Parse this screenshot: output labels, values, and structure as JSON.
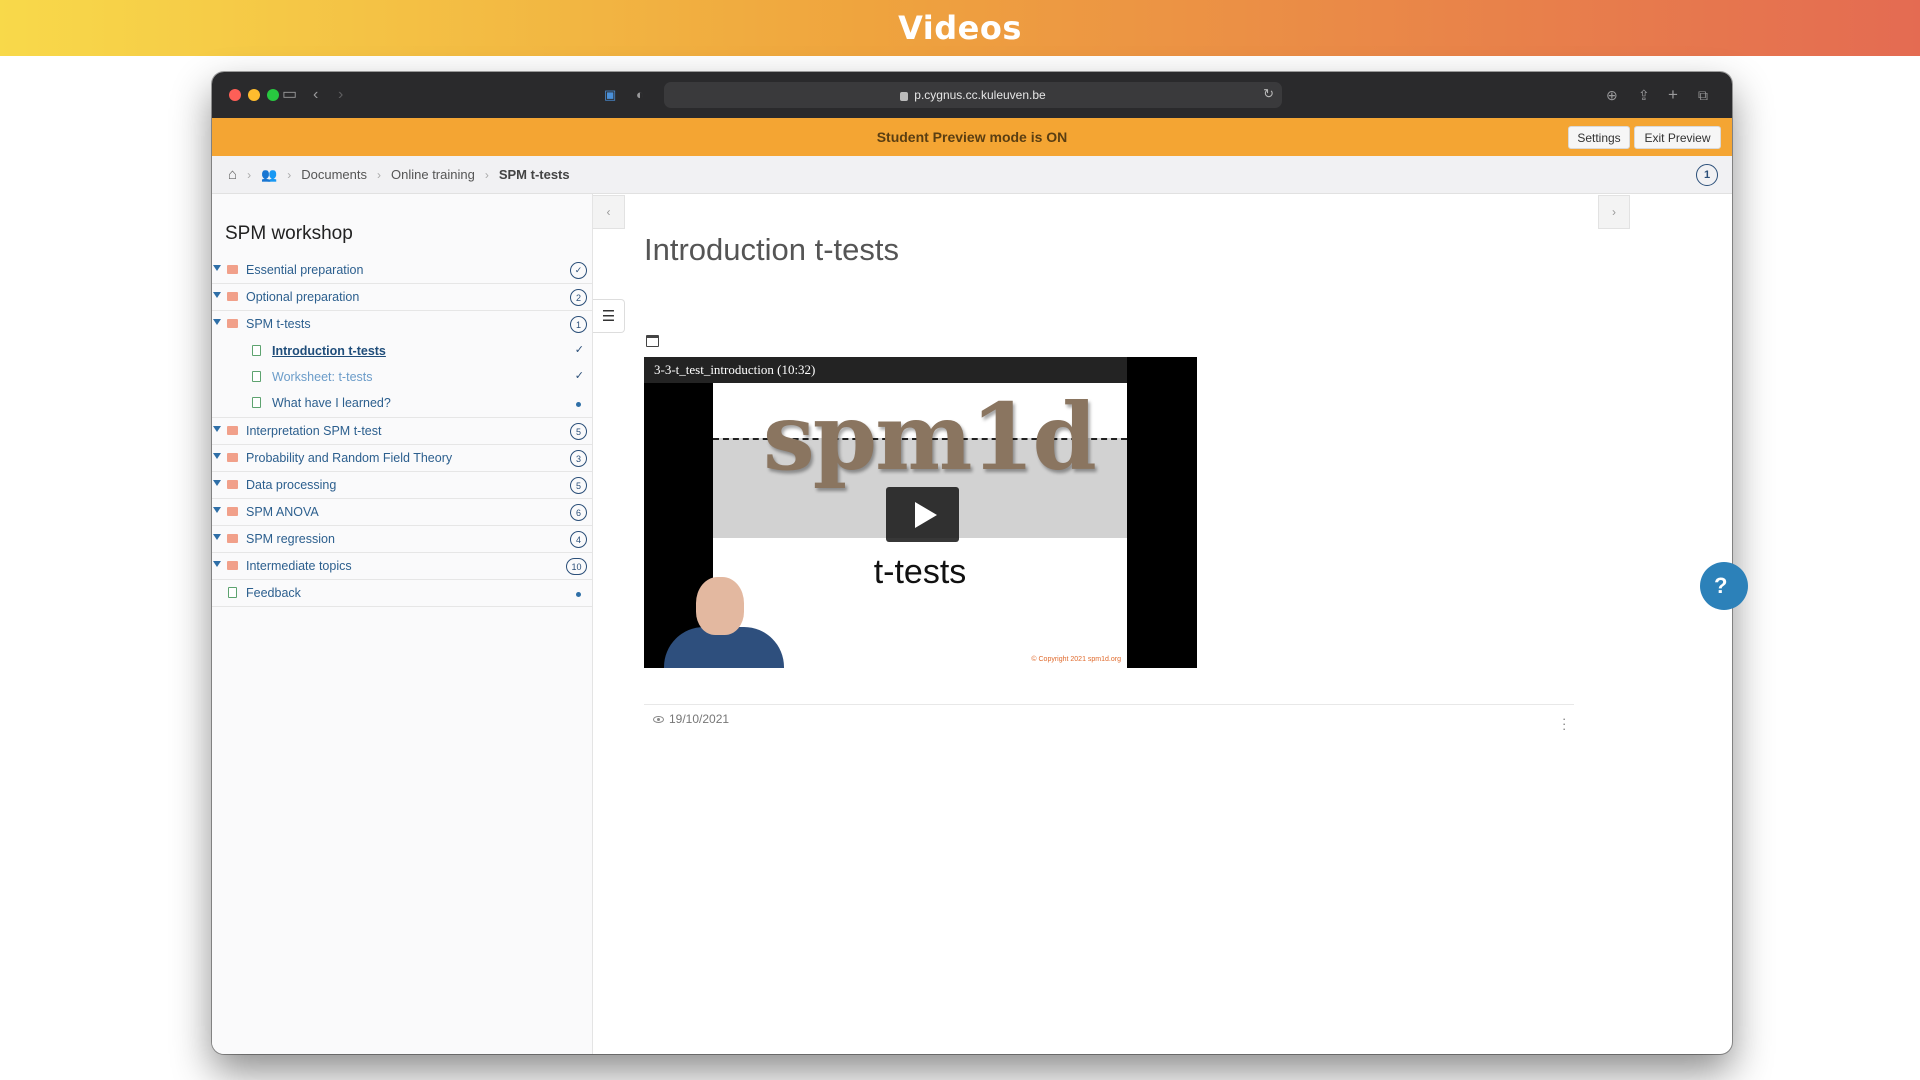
{
  "banner": {
    "title": "Videos"
  },
  "browser": {
    "url": "p.cygnus.cc.kuleuven.be"
  },
  "preview": {
    "message": "Student Preview mode is ON",
    "settings_label": "Settings",
    "exit_label": "Exit Preview"
  },
  "breadcrumb": {
    "items": [
      "Documents",
      "Online training",
      "SPM t-tests"
    ],
    "badge": "1"
  },
  "sidebar": {
    "title": "SPM workshop",
    "items": [
      {
        "label": "Essential preparation",
        "status": "✓"
      },
      {
        "label": "Optional preparation",
        "status": "2"
      },
      {
        "label": "SPM t-tests",
        "status": "1"
      },
      {
        "label": "Introduction t-tests",
        "status": "✓"
      },
      {
        "label": "Worksheet: t-tests",
        "status": "✓"
      },
      {
        "label": "What have I learned?",
        "status": "dot"
      },
      {
        "label": "Interpretation SPM t-test",
        "status": "5"
      },
      {
        "label": "Probability and Random Field Theory",
        "status": "3"
      },
      {
        "label": "Data processing",
        "status": "5"
      },
      {
        "label": "SPM ANOVA",
        "status": "6"
      },
      {
        "label": "SPM regression",
        "status": "4"
      },
      {
        "label": "Intermediate topics",
        "status": "10"
      },
      {
        "label": "Feedback",
        "status": "dot"
      }
    ]
  },
  "content": {
    "title": "Introduction t-tests",
    "video": {
      "caption": "3-3-t_test_introduction (10:32)",
      "slide_logo": "spm1d",
      "slide_subtitle": "t-tests",
      "copyright": "© Copyright 2021 spm1d.org"
    },
    "date": "19/10/2021"
  },
  "help": {
    "label": "?"
  },
  "colors": {
    "accent": "#2b4f79",
    "preview_bar": "#f4a533",
    "help_button": "#2c81b9"
  }
}
